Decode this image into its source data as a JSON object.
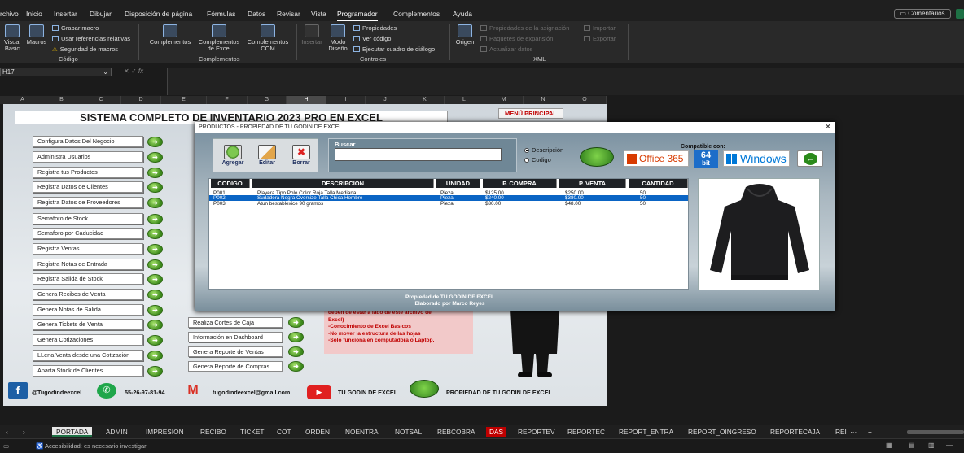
{
  "menu": {
    "tabs": [
      "rchivo",
      "Inicio",
      "Insertar",
      "Dibujar",
      "Disposición de página",
      "Fórmulas",
      "Datos",
      "Revisar",
      "Vista",
      "Programador",
      "Complementos",
      "Ayuda"
    ],
    "active": "Programador",
    "comments": "Comentarios"
  },
  "ribbon": {
    "codigo": {
      "visual_basic": "Visual Basic",
      "macros": "Macros",
      "grabar": "Grabar macro",
      "usar_ref": "Usar referencias relativas",
      "seguridad": "Seguridad de macros",
      "label": "Código"
    },
    "complementos": {
      "comp": "Complementos",
      "comp_excel": "Complementos de Excel",
      "comp_com": "Complementos COM",
      "label": "Complementos"
    },
    "controles": {
      "insertar": "Insertar",
      "modo_diseno": "Modo Diseño",
      "propiedades": "Propiedades",
      "ver_codigo": "Ver código",
      "ejecutar": "Ejecutar cuadro de diálogo",
      "label": "Controles"
    },
    "xml": {
      "origen": "Origen",
      "prop_asig": "Propiedades de la asignación",
      "paquetes": "Paquetes de expansión",
      "actualizar": "Actualizar datos",
      "importar": "Importar",
      "exportar": "Exportar",
      "label": "XML"
    }
  },
  "formula": {
    "namebox": "H17",
    "fx": "fx"
  },
  "columns": [
    "A",
    "B",
    "C",
    "D",
    "E",
    "F",
    "G",
    "H",
    "I",
    "J",
    "K",
    "L",
    "M",
    "N",
    "O"
  ],
  "selected_column": "H",
  "sheet": {
    "title": "SISTEMA COMPLETO DE INVENTARIO 2023 PRO EN EXCEL",
    "menu_principal": "MENÚ PRINCIPAL",
    "left_buttons": [
      "Configura Datos Del Negocio",
      "Administra Usuarios",
      "Registra tus Productos",
      "Registra Datos de Clientes",
      "Registra Datos de Proveedores",
      "Semaforo de Stock",
      "Semaforo por Caducidad",
      "Registra Ventas",
      "Registra Notas de  Entrada",
      "Registra Salida de Stock",
      "Genera Recibos de Venta",
      "Genera Notas de Salida",
      "Genera Tickets de Venta",
      "Genera Cotizaciones",
      "LLena Venta desde una Cotización",
      "Aparta Stock de Clientes"
    ],
    "right_buttons": [
      "Realiza Cortes de Caja",
      "Información en Dashboard",
      "Genera Reporte de Ventas",
      "Genera Reporte de Compras"
    ],
    "notes": [
      "deben de estar a lado de este archivo de",
      "Excel)",
      "-Conocimiento de Excel Basicos",
      "-No mover la estructura de las hojas",
      "-Solo funciona en computadora o Laptop."
    ],
    "social": {
      "facebook": "@Tugodindeexcel",
      "whatsapp": "55-26-97-81-94",
      "gmail": "tugodindeexcel@gmail.com",
      "youtube": "TU GODIN DE EXCEL",
      "owner": "PROPIEDAD DE TU GODIN DE EXCEL"
    }
  },
  "dialog": {
    "title": "PRODUCTOS - PROPIEDAD DE TU GODIN DE EXCEL",
    "agregar": "Agregar",
    "editar": "Editar",
    "borrar": "Borrar",
    "buscar_label": "Buscar",
    "search_value": "",
    "radio_desc": "Descripción",
    "radio_cod": "Codigo",
    "compatible": "Compatible con:",
    "office": "Office 365",
    "bits": "64",
    "bit": "bit",
    "windows": "Windows",
    "headers": [
      "CODIGO",
      "DESCRIPCION",
      "UNIDAD",
      "P. COMPRA",
      "P. VENTA",
      "CANTIDAD"
    ],
    "rows": [
      [
        "P001",
        "Playera Tipo Polo Color Roja Talla Mediana",
        "Pieza",
        "$125.00",
        "$250.00",
        "50"
      ],
      [
        "P002",
        "Sudadera Negra Oversize Talla Chica Hombre",
        "Pieza",
        "$240.00",
        "$380.00",
        "50"
      ],
      [
        "P003",
        "Atun bestablexice 90 gramos",
        "Pieza",
        "$30.00",
        "$48.00",
        "50"
      ]
    ],
    "selected_row": 1,
    "footer1": "Propiedad de TU GODIN DE EXCEL",
    "footer2": "Elaborado por Marco Reyes"
  },
  "sheet_tabs": [
    "PORTADA",
    "ADMIN",
    "IMPRESION",
    "RECIBO",
    "TICKET",
    "COT",
    "ORDEN",
    "NOENTRA",
    "NOTSAL",
    "REBCOBRA",
    "DAS",
    "REPORTEV",
    "REPORTEC",
    "REPORT_ENTRA",
    "REPORT_OINGRESO",
    "REPORTECAJA",
    "REI"
  ],
  "active_tab": "PORTADA",
  "status": {
    "accessibility": "Accesibilidad: es necesario investigar"
  },
  "colors": {
    "accent_green": "#3d8a1c",
    "dialog_blue": "#0a64c4",
    "red_note": "#c00000"
  }
}
